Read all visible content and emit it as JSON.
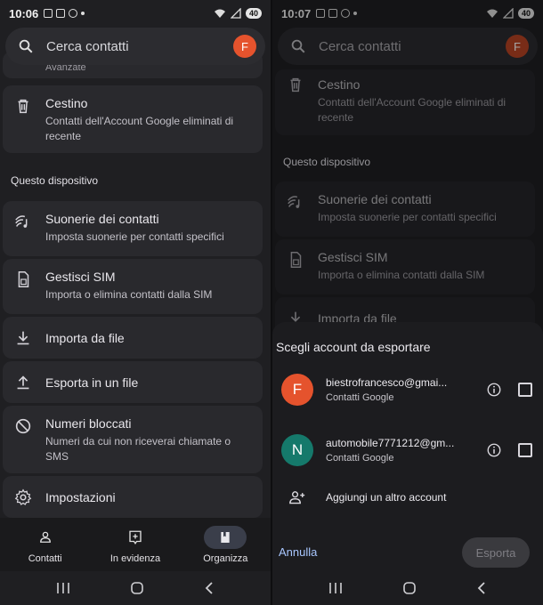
{
  "left": {
    "status": {
      "time": "10:06",
      "battery": "40"
    },
    "search": {
      "placeholder": "Cerca contatti",
      "avatar": "F"
    },
    "partial_label": "Avanzate",
    "trash": {
      "title": "Cestino",
      "line1": "Contatti dell'Account Google eliminati di",
      "line2": "recente"
    },
    "section": "Questo dispositivo",
    "items": [
      {
        "title": "Suonerie dei contatti",
        "sub": "Imposta suonerie per contatti specifici"
      },
      {
        "title": "Gestisci SIM",
        "sub": "Importa o elimina contatti dalla SIM"
      },
      {
        "title": "Importa da file"
      },
      {
        "title": "Esporta in un file"
      },
      {
        "title": "Numeri bloccati",
        "sub1": "Numeri da cui non riceverai chiamate o",
        "sub2": "SMS"
      },
      {
        "title": "Impostazioni"
      }
    ],
    "nav": [
      {
        "label": "Contatti"
      },
      {
        "label": "In evidenza"
      },
      {
        "label": "Organizza"
      }
    ]
  },
  "right": {
    "status": {
      "time": "10:07",
      "battery": "40"
    },
    "search": {
      "placeholder": "Cerca contatti",
      "avatar": "F"
    },
    "trash": {
      "title": "Cestino",
      "line1": "Contatti dell'Account Google eliminati di",
      "line2": "recente"
    },
    "section": "Questo dispositivo",
    "items": [
      {
        "title": "Suonerie dei contatti",
        "sub": "Imposta suonerie per contatti specifici"
      },
      {
        "title": "Gestisci SIM",
        "sub": "Importa o elimina contatti dalla SIM"
      },
      {
        "title": "Importa da file"
      }
    ],
    "sheet": {
      "title": "Scegli account da esportare",
      "accounts": [
        {
          "avatar": "F",
          "email": "biestrofrancesco@gmai...",
          "type": "Contatti Google",
          "color": "#e5532d"
        },
        {
          "avatar": "N",
          "email": "automobile7771212@gm...",
          "type": "Contatti Google",
          "color": "#15796b"
        }
      ],
      "add_account": "Aggiungi un altro account",
      "cancel": "Annulla",
      "export": "Esporta"
    }
  },
  "colors": {
    "accent": "#a9c7ff",
    "avatar_orange": "#e5532d",
    "avatar_teal": "#15796b"
  }
}
